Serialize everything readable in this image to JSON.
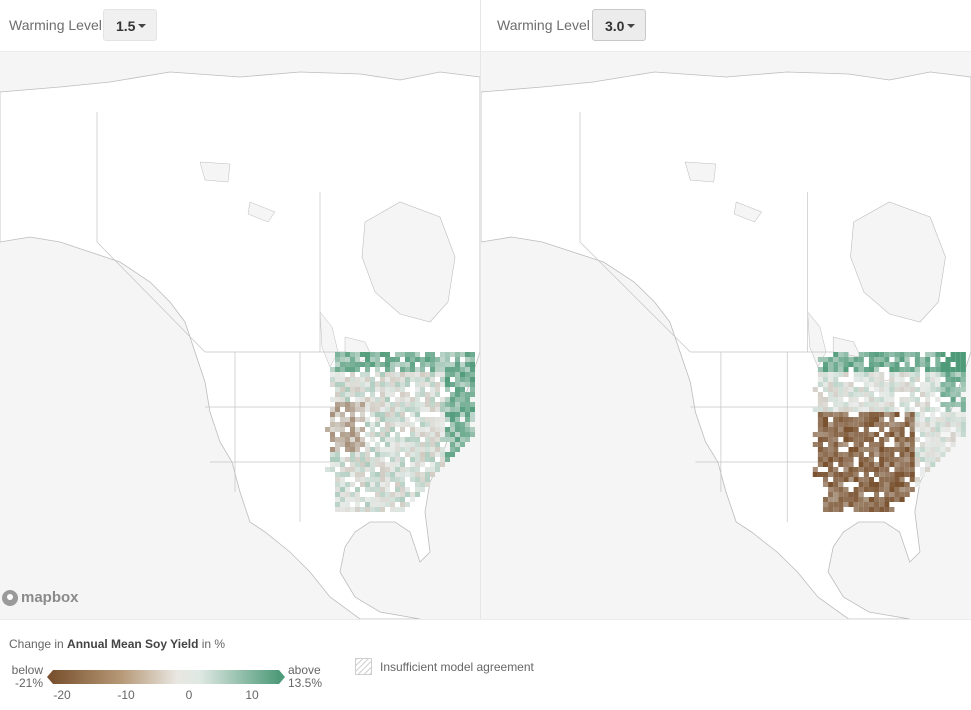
{
  "panels": [
    {
      "label": "Warming Level",
      "selected": "1.5"
    },
    {
      "label": "Warming Level",
      "selected": "3.0"
    }
  ],
  "attribution": "mapbox",
  "legend": {
    "title_prefix": "Change in ",
    "title_bold": "Annual Mean Soy Yield",
    "title_suffix": " in %",
    "below_label": "below",
    "below_value": "-21%",
    "above_label": "above",
    "above_value": "13.5%",
    "ticks": [
      "-20",
      "-10",
      "0",
      "10"
    ],
    "tick_values": [
      -20,
      -10,
      0,
      10
    ],
    "range": [
      -21,
      13.5
    ],
    "hatch_label": "Insufficient model agreement",
    "colors": {
      "low": "#7a5230",
      "mid": "#e9ecea",
      "high": "#4e9a79"
    }
  },
  "colors": {
    "land": "#ffffff",
    "water": "#f5f5f5",
    "border": "#c4c4c4",
    "coast": "#bdbdbd"
  }
}
